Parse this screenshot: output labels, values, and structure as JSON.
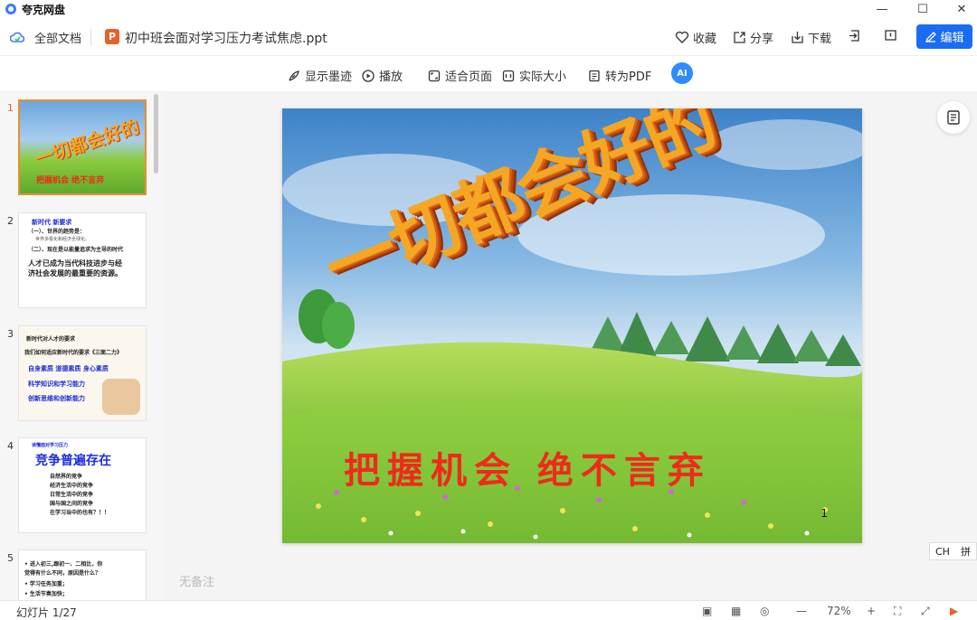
{
  "app": {
    "name": "夸克网盘"
  },
  "header": {
    "all_docs": "全部文档",
    "file_name": "初中班会面对学习压力考试焦虑.ppt",
    "ppt_badge": "P",
    "favorite": "收藏",
    "share": "分享",
    "download": "下载",
    "edit": "编辑"
  },
  "toolbar": {
    "show_ink": "显示墨迹",
    "play": "播放",
    "fit_page": "适合页面",
    "actual_size": "实际大小",
    "to_pdf": "转为PDF",
    "ai_label": "AI"
  },
  "thumbnails": [
    {
      "num": "1",
      "lines": [
        "一切都会好的",
        "把握机会 绝不言弃"
      ]
    },
    {
      "num": "2",
      "lines": [
        "新时代 新要求",
        "（一）、世界的趋势是：",
        "世界多极化和经济全球化。",
        "（二）、现在是以能量追求为主导的时代",
        "人才已成为当代科技进步与经",
        "济社会发展的最重要的资源。"
      ]
    },
    {
      "num": "3",
      "lines": [
        "新时代对人才的要求",
        "我们如何适应新时代的要求《三面二力》",
        "自身素质   道德素质   身心素质",
        "科学知识和学习能力",
        "创新思维和创新能力"
      ]
    },
    {
      "num": "4",
      "lines": [
        "读懂面对学习压力",
        "竞争普遍存在",
        "自然界的竞争",
        "经济生活中的竞争",
        "日常生活中的竞争",
        "国与国之间的竞争",
        "在学习当中的也有？！！"
      ]
    },
    {
      "num": "5",
      "lines": [
        "• 进入初三,跟初一、二相比，你",
        "  觉得有什么不同，原因是什么？",
        "• 学习任务加重；",
        "• 生活节奏加快；"
      ]
    }
  ],
  "slide": {
    "title": "一切都会好的",
    "subtitle": "把握机会  绝不言弃",
    "page_number": "1"
  },
  "notes_placeholder": "无备注",
  "ime": {
    "lang": "CH",
    "mode": "拼"
  },
  "status": {
    "slide_counter": "幻灯片 1/27",
    "zoom": "72%"
  },
  "colors": {
    "accent": "#1a6cf0",
    "ppt_orange": "#e8612d",
    "thumb_active_border": "#e8902d"
  }
}
